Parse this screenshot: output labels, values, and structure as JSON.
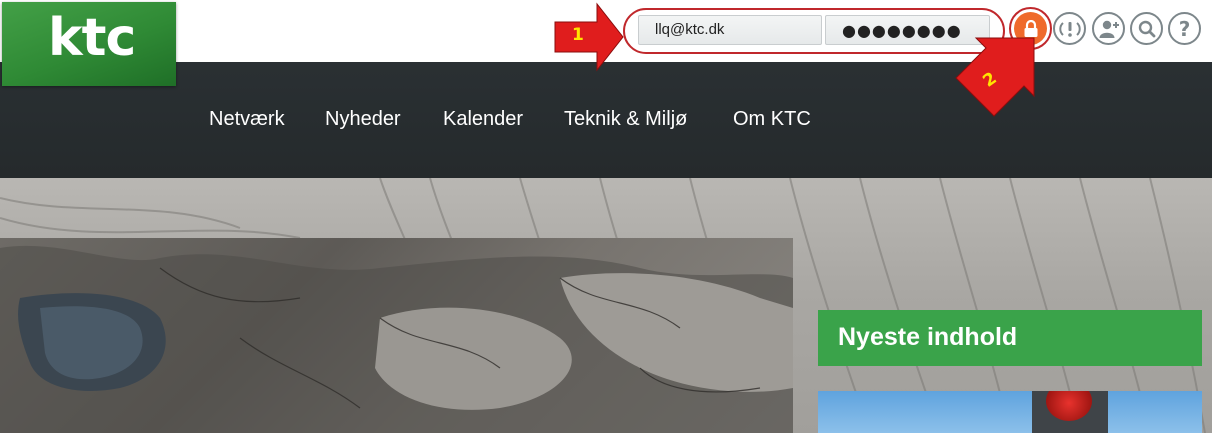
{
  "brand": {
    "logo_text": "ktc",
    "logo_color": "#2f8a35"
  },
  "login": {
    "email_value": "llq@ktc.dk",
    "password_mask": "●●●●●●●●"
  },
  "header_icons": [
    "lock-icon",
    "alert-icon",
    "add-user-icon",
    "search-icon",
    "help-icon"
  ],
  "annotations": {
    "marker_1": "1",
    "marker_2": "2"
  },
  "nav": {
    "items": [
      {
        "label": "Netværk"
      },
      {
        "label": "Nyheder"
      },
      {
        "label": "Kalender"
      },
      {
        "label": "Teknik & Miljø"
      },
      {
        "label": "Om KTC"
      }
    ]
  },
  "sidebar": {
    "latest_title": "Nyeste indhold"
  },
  "colors": {
    "accent_green": "#3aa34a",
    "lock_orange": "#ef6a2b",
    "annotation_red": "#c0282c",
    "nav_dark": "#272c2e"
  }
}
